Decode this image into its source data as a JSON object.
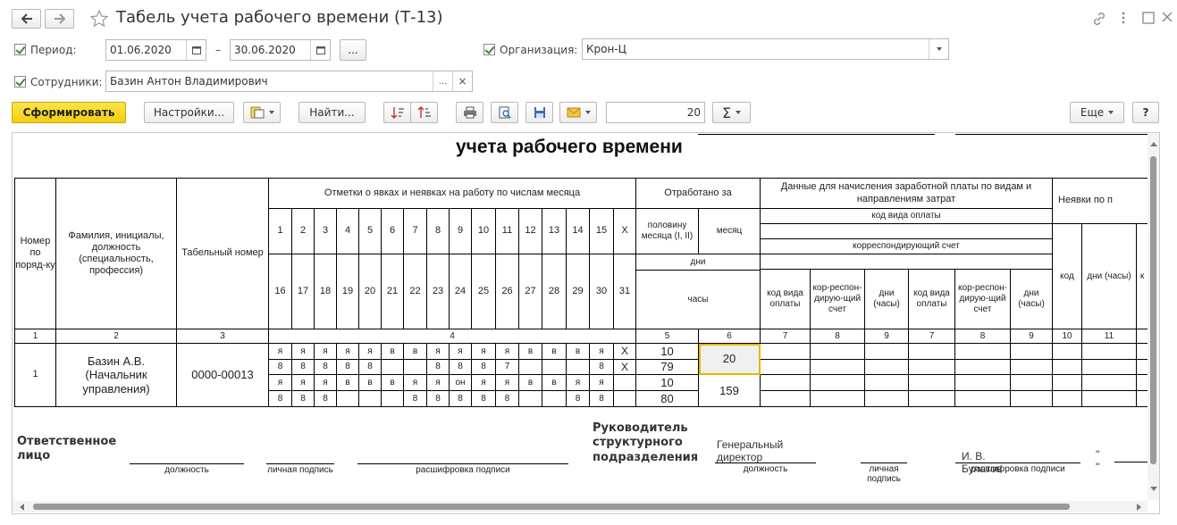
{
  "window": {
    "title": "Табель учета рабочего времени (Т-13)"
  },
  "filters": {
    "period_label": "Период:",
    "date_from": "01.06.2020",
    "dash": "–",
    "date_to": "30.06.2020",
    "more_button": "...",
    "org_label": "Организация:",
    "org_value": "Крон-Ц",
    "emp_label": "Сотрудники:",
    "emp_value": "Базин Антон Владимирович",
    "emp_more": "...",
    "emp_clear": "×"
  },
  "toolbar": {
    "generate": "Сформировать",
    "settings": "Настройки...",
    "find": "Найти...",
    "value": "20",
    "sigma": "Σ",
    "more": "Еще",
    "help": "?"
  },
  "report": {
    "title": "учета  рабочего времени",
    "h_num": "Номер по поряд-ку",
    "h_name": "Фамилия, инициалы, должность (специальность, профессия)",
    "h_tab": "Табельный номер",
    "h_marks": "Отметки о явках и неявках на работу по числам месяца",
    "h_worked": "Отработано за",
    "h_half": "половину месяца (I, II)",
    "h_month": "месяц",
    "h_days": "дни",
    "h_hours": "часы",
    "h_pay": "Данные для начисления заработной платы по видам и направлениям затрат",
    "h_paycode": "код вида оплаты",
    "h_corr": "корреспондирующий счет",
    "h_code_pay": "код вида оплаты",
    "h_corr_acc": "коp-респон-дирую-щий счет",
    "h_days_hours": "дни (часы)",
    "h_absence": "Неявки по п",
    "h_code": "код",
    "h_kv": "к",
    "days_top": [
      "1",
      "2",
      "3",
      "4",
      "5",
      "6",
      "7",
      "8",
      "9",
      "10",
      "11",
      "12",
      "13",
      "14",
      "15",
      "X"
    ],
    "days_bottom": [
      "16",
      "17",
      "18",
      "19",
      "20",
      "21",
      "22",
      "23",
      "24",
      "25",
      "26",
      "27",
      "28",
      "29",
      "30",
      "31"
    ],
    "colnums": {
      "c1": "1",
      "c2": "2",
      "c3": "3",
      "c4": "4",
      "c5": "5",
      "c6": "6",
      "c7": "7",
      "c8": "8",
      "c9": "9",
      "c7b": "7",
      "c8b": "8",
      "c9b": "9",
      "c10": "10",
      "c11": "11"
    },
    "row": {
      "num": "1",
      "name": "Базин А.В. (Начальник управления)",
      "tab": "0000-00013",
      "r1": [
        "я",
        "я",
        "я",
        "я",
        "я",
        "в",
        "в",
        "я",
        "я",
        "я",
        "я",
        "в",
        "в",
        "в",
        "я",
        "X"
      ],
      "r2": [
        "8",
        "8",
        "8",
        "8",
        "8",
        "",
        "",
        "8",
        "8",
        "8",
        "7",
        "",
        "",
        "",
        "8",
        "X"
      ],
      "r3": [
        "я",
        "я",
        "я",
        "в",
        "в",
        "в",
        "я",
        "я",
        "он",
        "я",
        "я",
        "в",
        "в",
        "я",
        "я",
        ""
      ],
      "r4": [
        "8",
        "8",
        "8",
        "",
        "",
        "",
        "8",
        "8",
        "8",
        "8",
        "8",
        "",
        "",
        "8",
        "8",
        ""
      ],
      "half1_days": "10",
      "half1_hours": "79",
      "half2_days": "10",
      "half2_hours": "80",
      "month_days": "20",
      "month_hours": "159"
    },
    "footer": {
      "resp": "Ответственное лицо",
      "pos": "должность",
      "sign": "личная подпись",
      "decode": "расшифровка подписи",
      "head": "Руководитель структурного подразделения",
      "head_pos_val": "Генеральный директор",
      "head_name": "И. В. Булатов",
      "quote": "\" \""
    }
  }
}
